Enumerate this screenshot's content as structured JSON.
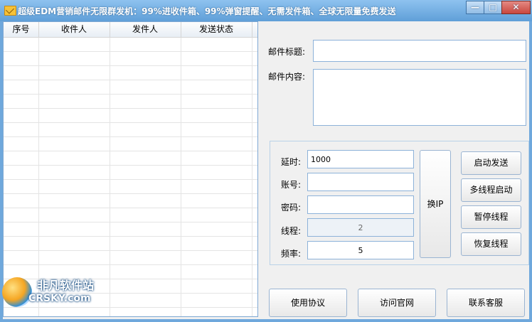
{
  "window": {
    "title": "超级EDM营销邮件无限群发机：99%进收件箱、99%弹窗提醒、无需发件箱、全球无限量免费发送",
    "controls": [
      "—",
      "□",
      "✕"
    ]
  },
  "table": {
    "headers": [
      "序号",
      "收件人",
      "发件人",
      "发送状态"
    ],
    "row_count": 20
  },
  "form": {
    "subject_label": "邮件标题:",
    "subject_value": "",
    "content_label": "邮件内容:",
    "content_value": ""
  },
  "settings": {
    "delay_label": "延时:",
    "delay_value": "1000",
    "account_label": "账号:",
    "account_value": "",
    "password_label": "密码:",
    "password_value": "",
    "threads_label": "线程:",
    "threads_value": "2",
    "frequency_label": "频率:",
    "frequency_value": "5"
  },
  "buttons": {
    "change_ip": "换IP",
    "start_send": "启动发送",
    "multi_thread": "多线程启动",
    "pause_thread": "暂停线程",
    "resume_thread": "恢复线程",
    "terms": "使用协议",
    "website": "访问官网",
    "support": "联系客服"
  },
  "watermark": {
    "cn": "非凡软件站",
    "en": "CRSKY.com"
  }
}
